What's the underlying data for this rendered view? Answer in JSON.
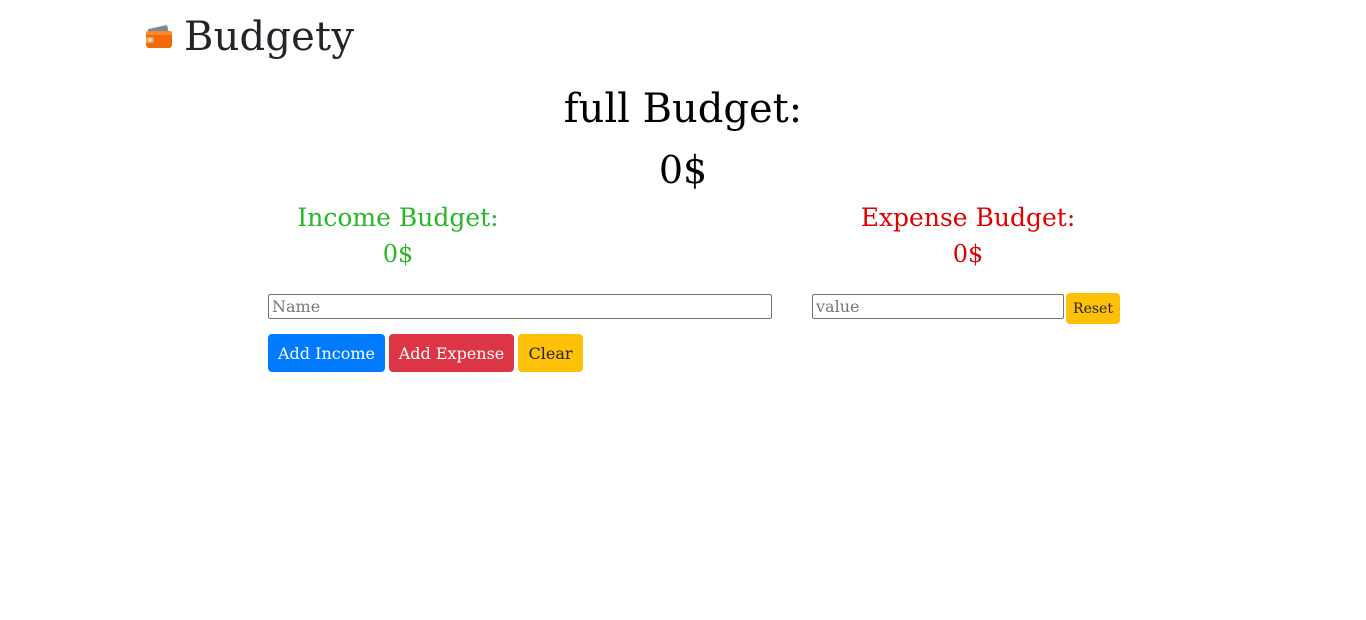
{
  "header": {
    "title": "Budgety",
    "icon": "wallet-icon"
  },
  "summary": {
    "full_label": "full Budget:",
    "full_value": "0$"
  },
  "income": {
    "title": "Income Budget:",
    "value": "0$",
    "color": "#28b728"
  },
  "expense": {
    "title": "Expense Budget:",
    "value": "0$",
    "color": "#e00000"
  },
  "form": {
    "name_placeholder": "Name",
    "name_value": "",
    "value_placeholder": "value",
    "value_value": "",
    "reset_label": "Reset",
    "add_income_label": "Add Income",
    "add_expense_label": "Add Expense",
    "clear_label": "Clear"
  },
  "colors": {
    "primary": "#007bff",
    "danger": "#dc3545",
    "warning": "#ffc107"
  }
}
